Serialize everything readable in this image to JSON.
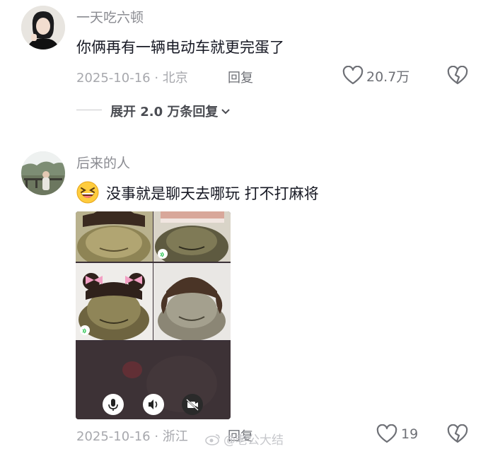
{
  "comments": [
    {
      "username": "一天吃六顿",
      "text": "你俩再有一辆电动车就更完蛋了",
      "date_location": "2025-10-16 · 北京",
      "reply_label": "回复",
      "like_count": "20.7万",
      "expand_replies": "展开 2.0 万条回复",
      "icons": [
        "avatar",
        "heart-icon",
        "broken-heart-icon",
        "chevron-down-icon"
      ]
    },
    {
      "username": "后来的人",
      "emoji": "grinning-squint-emoji",
      "text": "没事就是聊天去哪玩 打不打麻将",
      "date_location": "2025-10-16 · 浙江",
      "reply_label": "回复",
      "like_count": "19",
      "icons": [
        "avatar",
        "heart-icon",
        "broken-heart-icon"
      ],
      "attachment": {
        "type": "video-call-screenshot",
        "tiles": [
          "frog-bangs-tile",
          "frog-headband-tile",
          "frog-pink-bows-tile",
          "frog-pigtails-tile",
          "blurred-camera-tile"
        ],
        "controls": [
          "microphone-icon",
          "speaker-icon",
          "camera-off-icon"
        ]
      }
    }
  ],
  "watermark": "@老公大结",
  "colors": {
    "text": "#161823",
    "muted": "#a7a8ad",
    "reply": "#6e7076"
  }
}
